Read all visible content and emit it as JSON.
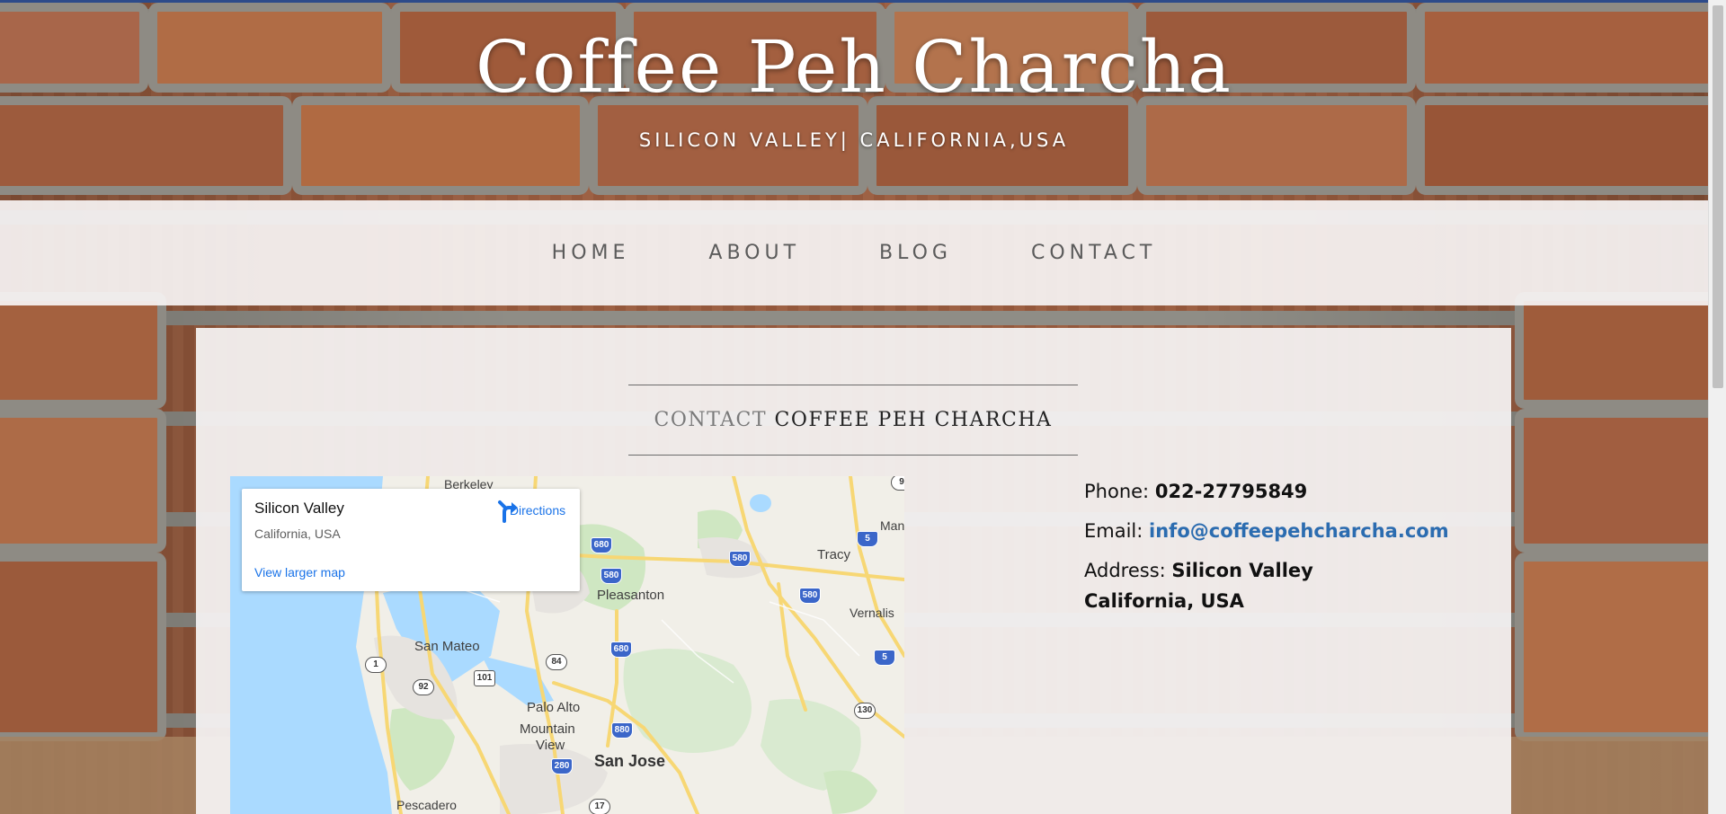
{
  "header": {
    "title": "Coffee Peh Charcha",
    "tagline": "SILICON VALLEY| CALIFORNIA,USA"
  },
  "nav": {
    "items": [
      {
        "label": "HOME"
      },
      {
        "label": "ABOUT"
      },
      {
        "label": "BLOG"
      },
      {
        "label": "CONTACT"
      }
    ]
  },
  "contact_section": {
    "heading_light": "CONTACT",
    "heading_bold": "COFFEE PEH CHARCHA"
  },
  "map": {
    "place_title": "Silicon Valley",
    "place_subtitle": "California, USA",
    "directions_label": "Directions",
    "view_larger_label": "View larger map",
    "labels": {
      "berkeley": "Berkeley",
      "tracy": "Tracy",
      "man": "Man",
      "pleasanton": "Pleasanton",
      "vernalis": "Vernalis",
      "san_mateo": "San Mateo",
      "palo_alto": "Palo Alto",
      "mountain": "Mountain",
      "view": "View",
      "san_jose": "San Jose",
      "pescadero": "Pescadero"
    },
    "shields": {
      "i680a": "680",
      "i580a": "580",
      "i580b": "580",
      "i580c": "580",
      "i5a": "5",
      "i5b": "5",
      "i680b": "680",
      "i880": "880",
      "i280": "280",
      "us101": "101",
      "ca1": "1",
      "ca92": "92",
      "ca84": "84",
      "ca130": "130",
      "ca17": "17",
      "ca9": "9"
    },
    "colors": {
      "water": "#aadaff",
      "land": "#f1efe8",
      "park": "#cfe7c2",
      "highway": "#f7d774",
      "urban": "#e6e3df"
    }
  },
  "contact_info": {
    "phone_label": "Phone:",
    "phone_value": "022-27795849",
    "email_label": "Email:",
    "email_value": "info@coffeepehcharcha.com",
    "address_label": "Address:",
    "address_line1": "Silicon Valley",
    "address_line2": "California, USA"
  },
  "theme": {
    "accent_link": "#2b6cb0",
    "top_strip": "#2d4b8a",
    "brick": "#9a5c3e"
  }
}
